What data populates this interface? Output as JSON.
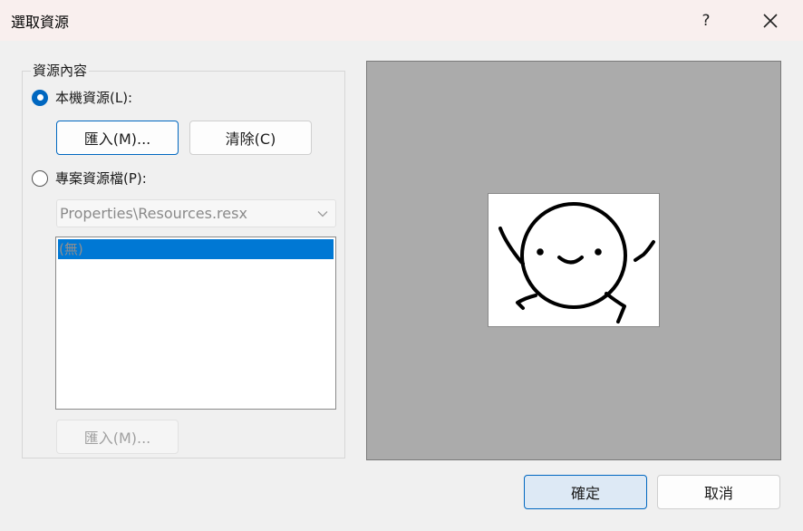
{
  "dialog": {
    "title": "選取資源",
    "help_label": "?"
  },
  "resource_group": {
    "label": "資源內容",
    "local": {
      "label": "本機資源(L):",
      "selected": true,
      "import_button": "匯入(M)...",
      "clear_button": "清除(C)"
    },
    "project": {
      "label": "專案資源檔(P):",
      "selected": false,
      "file_select": "Properties\\Resources.resx",
      "list_items": [
        "(無)"
      ],
      "import_button": "匯入(M)..."
    }
  },
  "preview": {
    "background_color": "#ababab",
    "image": "smiley-stick-figure"
  },
  "footer": {
    "ok_button": "確定",
    "cancel_button": "取消"
  }
}
